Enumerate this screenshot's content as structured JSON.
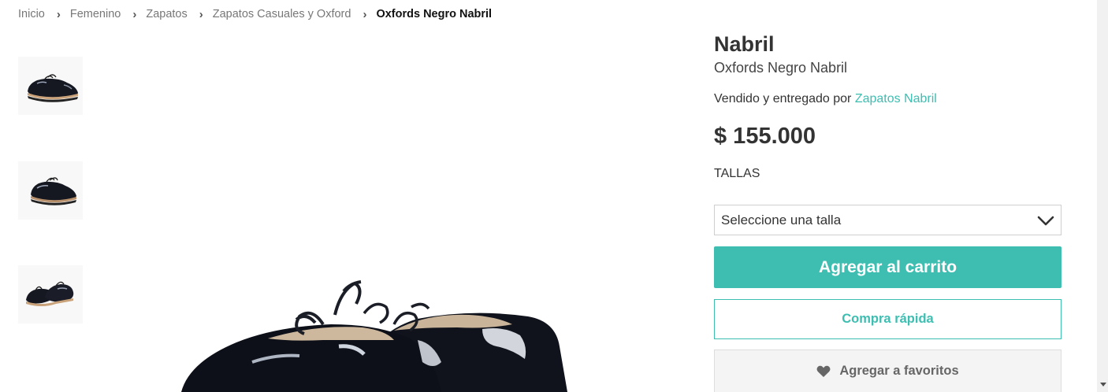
{
  "breadcrumb": {
    "items": [
      "Inicio",
      "Femenino",
      "Zapatos",
      "Zapatos Casuales y Oxford"
    ],
    "current": "Oxfords Negro Nabril",
    "separator": "›"
  },
  "gallery": {
    "thumbnails": [
      "shoe-thumbnail-side",
      "shoe-thumbnail-pair",
      "shoe-thumbnail-pair-angle"
    ],
    "main_image": "black-patent-oxford-shoes"
  },
  "product": {
    "brand": "Nabril",
    "name": "Oxfords Negro Nabril",
    "seller_prefix": "Vendido y entregado por",
    "seller_name": "Zapatos Nabril",
    "price": "$ 155.000",
    "sizes_label": "TALLAS",
    "size_select_value": "Seleccione una talla"
  },
  "actions": {
    "add_to_cart": "Agregar al carrito",
    "quick_buy": "Compra rápida",
    "add_to_favorites": "Agregar a favoritos"
  },
  "icons": {
    "select": "chevron-down-icon",
    "favorites": "heart-icon"
  },
  "colors": {
    "accent": "#3dbeb1",
    "text": "#333333",
    "breadcrumb": "#777777",
    "favorites_bg": "#f4f4f4"
  }
}
